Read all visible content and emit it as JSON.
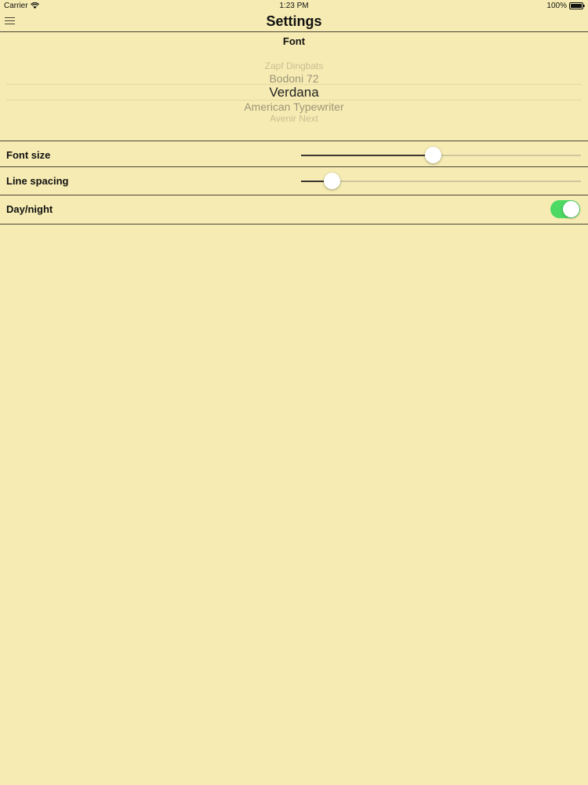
{
  "status_bar": {
    "carrier": "Carrier",
    "time": "1:23 PM",
    "battery": "100%"
  },
  "nav": {
    "title": "Settings",
    "menu_icon": "hamburger-menu-icon"
  },
  "font_section": {
    "title": "Font",
    "options": [
      "Zapf Dingbats",
      "Bodoni 72",
      "Verdana",
      "American Typewriter",
      "Avenir Next"
    ],
    "selected": "Verdana"
  },
  "settings": {
    "font_size": {
      "label": "Font size",
      "value": 0.47
    },
    "line_spacing": {
      "label": "Line spacing",
      "value": 0.11
    },
    "day_night": {
      "label": "Day/night",
      "enabled": true
    }
  },
  "colors": {
    "background": "#f6ecb3",
    "toggle_on": "#4cd964",
    "divider": "#4a4436"
  }
}
